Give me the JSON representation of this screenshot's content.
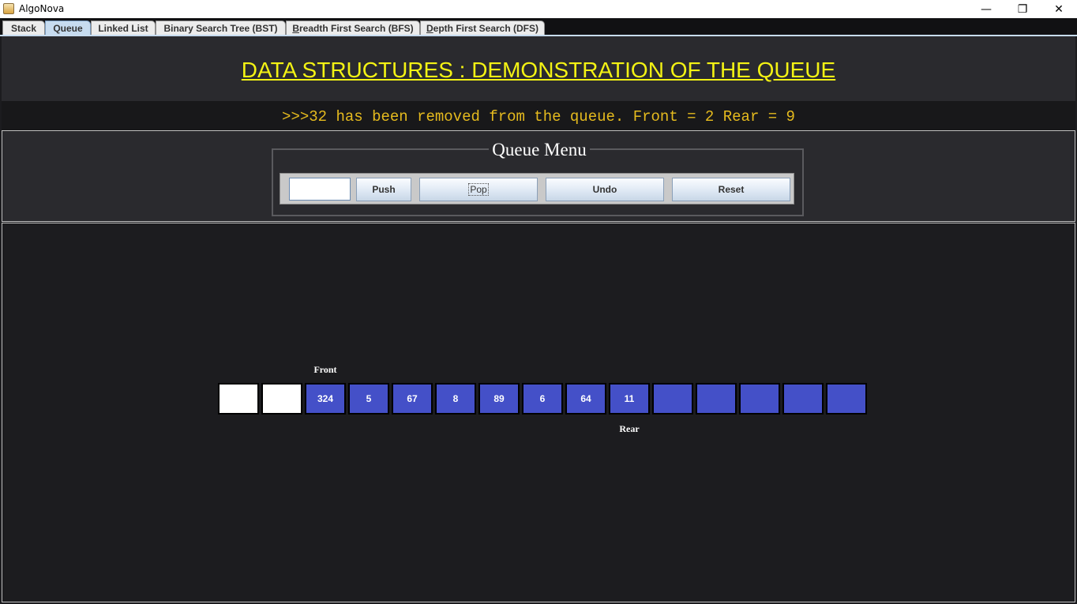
{
  "window": {
    "title": "AlgoNova",
    "minimize_glyph": "—",
    "maximize_glyph": "❐",
    "close_glyph": "✕"
  },
  "tabs": [
    {
      "label": "Stack",
      "active": false
    },
    {
      "label": "Queue",
      "active": true
    },
    {
      "label": "Linked List",
      "active": false
    },
    {
      "label": "Binary Search Tree (BST)",
      "active": false
    },
    {
      "label_first": "B",
      "label_rest": "readth First Search (BFS)",
      "active": false
    },
    {
      "label_first": "D",
      "label_rest": "epth First Search (DFS)",
      "active": false
    }
  ],
  "header": {
    "title": "DATA STRUCTURES : DEMONSTRATION OF THE QUEUE"
  },
  "status": {
    "message": ">>>32 has been removed from the queue. Front = 2 Rear = 9"
  },
  "menu": {
    "title": "Queue Menu",
    "input_value": "",
    "push_label": "Push",
    "pop_label": "Pop",
    "undo_label": "Undo",
    "reset_label": "Reset"
  },
  "queue": {
    "cells": [
      "",
      "",
      "324",
      "5",
      "67",
      "8",
      "89",
      "6",
      "64",
      "11",
      "",
      "",
      "",
      "",
      ""
    ],
    "cell_states": [
      "empty",
      "empty",
      "filled",
      "filled",
      "filled",
      "filled",
      "filled",
      "filled",
      "filled",
      "filled",
      "slot",
      "slot",
      "slot",
      "slot",
      "slot"
    ],
    "front_index": 2,
    "rear_index": 9,
    "front_label": "Front",
    "rear_label": "Rear"
  },
  "colors": {
    "accent_title": "#f3f214",
    "status_text": "#e6bb1e",
    "cell_fill": "#4450c8",
    "cell_empty": "#ffffff"
  }
}
